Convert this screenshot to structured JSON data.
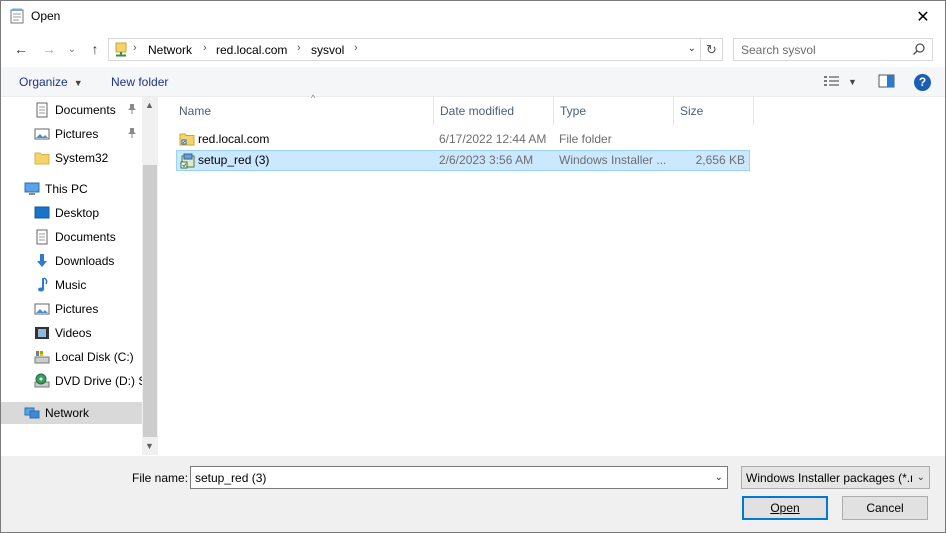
{
  "window": {
    "title": "Open",
    "close_glyph": "✕"
  },
  "nav": {
    "back_glyph": "←",
    "forward_glyph": "→",
    "recent_glyph": "⌄",
    "up_glyph": "↑",
    "breadcrumbs": [
      "Network",
      "red.local.com",
      "sysvol"
    ],
    "crumb_separator": "›",
    "dropdown_glyph": "⌄",
    "refresh_glyph": "↻",
    "search_placeholder": "Search sysvol"
  },
  "command_bar": {
    "organize_label": "Organize",
    "new_folder_label": "New folder",
    "help_glyph": "?"
  },
  "sidebar": {
    "items": [
      {
        "label": "Documents",
        "icon": "documents-icon",
        "pinned": true
      },
      {
        "label": "Pictures",
        "icon": "pictures-icon",
        "pinned": true
      },
      {
        "label": "System32",
        "icon": "folder-icon",
        "pinned": false
      },
      {
        "label": "This PC",
        "icon": "computer-icon",
        "pinned": false
      },
      {
        "label": "Desktop",
        "icon": "desktop-icon",
        "pinned": false
      },
      {
        "label": "Documents",
        "icon": "documents-icon",
        "pinned": false
      },
      {
        "label": "Downloads",
        "icon": "downloads-icon",
        "pinned": false
      },
      {
        "label": "Music",
        "icon": "music-icon",
        "pinned": false
      },
      {
        "label": "Pictures",
        "icon": "pictures-icon",
        "pinned": false
      },
      {
        "label": "Videos",
        "icon": "videos-icon",
        "pinned": false
      },
      {
        "label": "Local Disk (C:)",
        "icon": "disk-icon",
        "pinned": false
      },
      {
        "label": "DVD Drive (D:) SS",
        "icon": "dvd-icon",
        "pinned": false
      },
      {
        "label": "Network",
        "icon": "network-icon",
        "pinned": false,
        "selected": true
      }
    ],
    "pin_glyph": "📌"
  },
  "file_list": {
    "columns": [
      "Name",
      "Date modified",
      "Type",
      "Size"
    ],
    "sort_glyph": "^",
    "rows": [
      {
        "name": "red.local.com",
        "date": "6/17/2022 12:44 AM",
        "type": "File folder",
        "size": "",
        "icon": "shared-folder-icon"
      },
      {
        "name": "setup_red (3)",
        "date": "2/6/2023 3:56 AM",
        "type": "Windows Installer ...",
        "size": "2,656 KB",
        "icon": "msi-package-icon",
        "selected": true
      }
    ]
  },
  "bottom": {
    "file_name_label": "File name:",
    "file_name_value": "setup_red (3)",
    "filter_value": "Windows Installer packages (*.r",
    "open_label": "Open",
    "cancel_label": "Cancel"
  },
  "colors": {
    "accent": "#0078d7",
    "selection_bg": "#cce8ff",
    "selection_border": "#99d1ff",
    "link_blue": "#1e3287"
  }
}
